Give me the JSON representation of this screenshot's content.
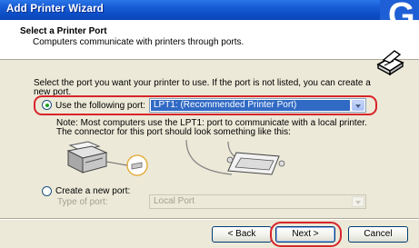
{
  "window": {
    "title": "Add Printer Wizard",
    "badge_letter": "G"
  },
  "header": {
    "title": "Select a Printer Port",
    "subtitle": "Computers communicate with printers through ports."
  },
  "body": {
    "intro_line1": "Select the port you want your printer to use.  If the port is not listed, you can create a",
    "intro_line2": "new port.",
    "use_port_label": "Use the following port:",
    "use_port_value": "LPT1: (Recommended Printer Port)",
    "note_line1": "Note: Most computers use the LPT1: port to communicate with a local printer.",
    "note_line2": "The connector for this port should look something like this:",
    "create_port_label": "Create a new port:",
    "type_of_port_label": "Type of port:",
    "type_of_port_value": "Local Port"
  },
  "buttons": {
    "back": "< Back",
    "next": "Next >",
    "cancel": "Cancel"
  },
  "colors": {
    "title_bar": "#0d4ec6",
    "highlight_oval": "#d8242a",
    "selected_item": "#316ac5"
  }
}
